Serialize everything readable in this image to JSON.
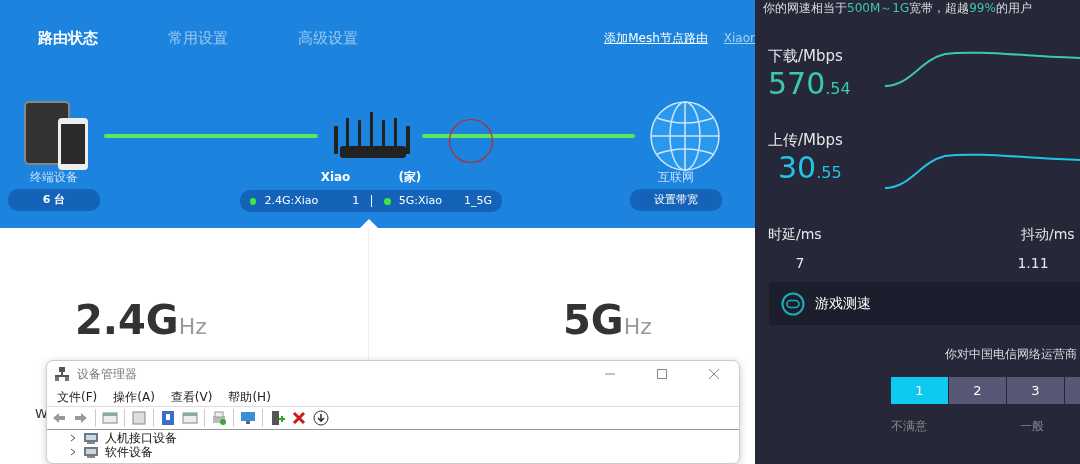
{
  "router_page": {
    "tabs": [
      {
        "label": "路由状态",
        "selected": true
      },
      {
        "label": "常用设置",
        "selected": false
      },
      {
        "label": "高级设置",
        "selected": false
      }
    ],
    "links": [
      "添加Mesh节点路由",
      "Xiaor"
    ],
    "devices": {
      "label": "终端设备",
      "count": "6 台"
    },
    "router": {
      "name_start": "Xiao",
      "name_end": "(家)",
      "wifi": [
        {
          "ssid": "2.4G:Xiao",
          "tail": "1",
          "online": true
        },
        {
          "ssid": "5G:Xiao",
          "tail": "1_5G",
          "online": true
        }
      ]
    },
    "internet": {
      "label": "互联网",
      "button": "设置带宽"
    },
    "bands": [
      {
        "value": "2.4G",
        "unit": "Hz"
      },
      {
        "value": "5G",
        "unit": "Hz"
      }
    ],
    "partial_text": "W"
  },
  "speed_test": {
    "summary": [
      {
        "text": "你的网速相当于",
        "highlight": false
      },
      {
        "text": "500M～1G",
        "highlight": true
      },
      {
        "text": "宽带，超越",
        "highlight": false
      },
      {
        "text": "99%",
        "highlight": true
      },
      {
        "text": "的用户",
        "highlight": false
      }
    ],
    "download": {
      "label": "下载/Mbps",
      "integer": "570",
      "decimal": ".54",
      "color": "#3cc9a7"
    },
    "upload": {
      "label": "上传/Mbps",
      "integer": "30",
      "decimal": ".55",
      "color": "#22c4e6"
    },
    "latency": {
      "label": "时延/ms",
      "value": "7"
    },
    "jitter": {
      "label": "抖动/ms",
      "value": "1.11"
    },
    "game_button": "游戏测速",
    "survey": {
      "question": "你对中国电信网络运营商",
      "ratings": [
        {
          "label": "1",
          "selected": true
        },
        {
          "label": "2",
          "selected": false
        },
        {
          "label": "3",
          "selected": false
        }
      ],
      "scale_labels": [
        "不满意",
        "一般"
      ]
    }
  },
  "device_manager": {
    "title": "设备管理器",
    "menu": [
      "文件(F)",
      "操作(A)",
      "查看(V)",
      "帮助(H)"
    ],
    "tree": [
      {
        "label": "人机接口设备",
        "expanded": false
      },
      {
        "label": "软件设备",
        "expanded": false
      }
    ]
  }
}
